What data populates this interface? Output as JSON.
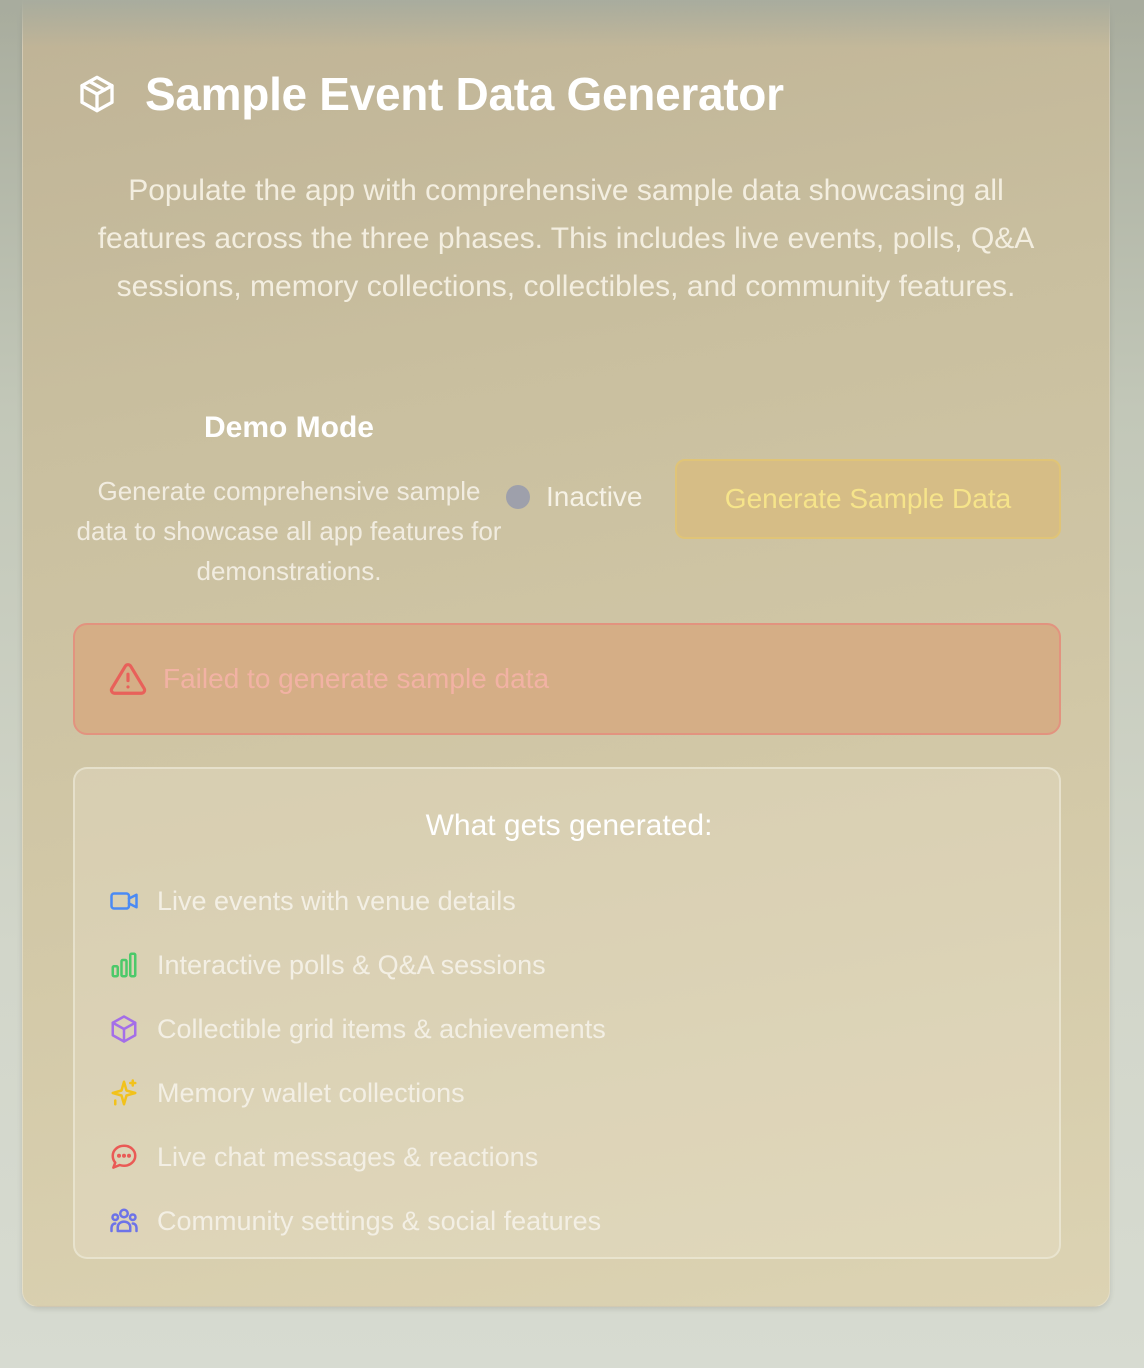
{
  "header": {
    "title": "Sample Event Data Generator",
    "icon": "cube-icon"
  },
  "intro": {
    "text": "Populate the app with comprehensive sample data showcasing all features across the three phases. This includes live events, polls, Q&A sessions, memory collections, collectibles, and community features."
  },
  "demo": {
    "heading": "Demo Mode",
    "description": "Generate comprehensive sample data to showcase all app features for demonstrations.",
    "status_label": "Inactive",
    "status_color": "#9ea0ab",
    "button_label": "Generate Sample Data"
  },
  "error": {
    "icon": "warning-triangle-icon",
    "message": "Failed to generate sample data",
    "color": "#e8615a"
  },
  "features": {
    "title": "What gets generated:",
    "items": [
      {
        "icon": "video-camera-icon",
        "label": "Live events with venue details",
        "color": "#4a8af4"
      },
      {
        "icon": "bar-chart-icon",
        "label": "Interactive polls & Q&A sessions",
        "color": "#4cc96a"
      },
      {
        "icon": "cube-icon",
        "label": "Collectible grid items & achievements",
        "color": "#a46ee8"
      },
      {
        "icon": "sparkles-icon",
        "label": "Memory wallet collections",
        "color": "#f2c21b"
      },
      {
        "icon": "chat-bubble-icon",
        "label": "Live chat messages & reactions",
        "color": "#ea5a55"
      },
      {
        "icon": "users-icon",
        "label": "Community settings & social features",
        "color": "#6d73e8"
      }
    ]
  }
}
